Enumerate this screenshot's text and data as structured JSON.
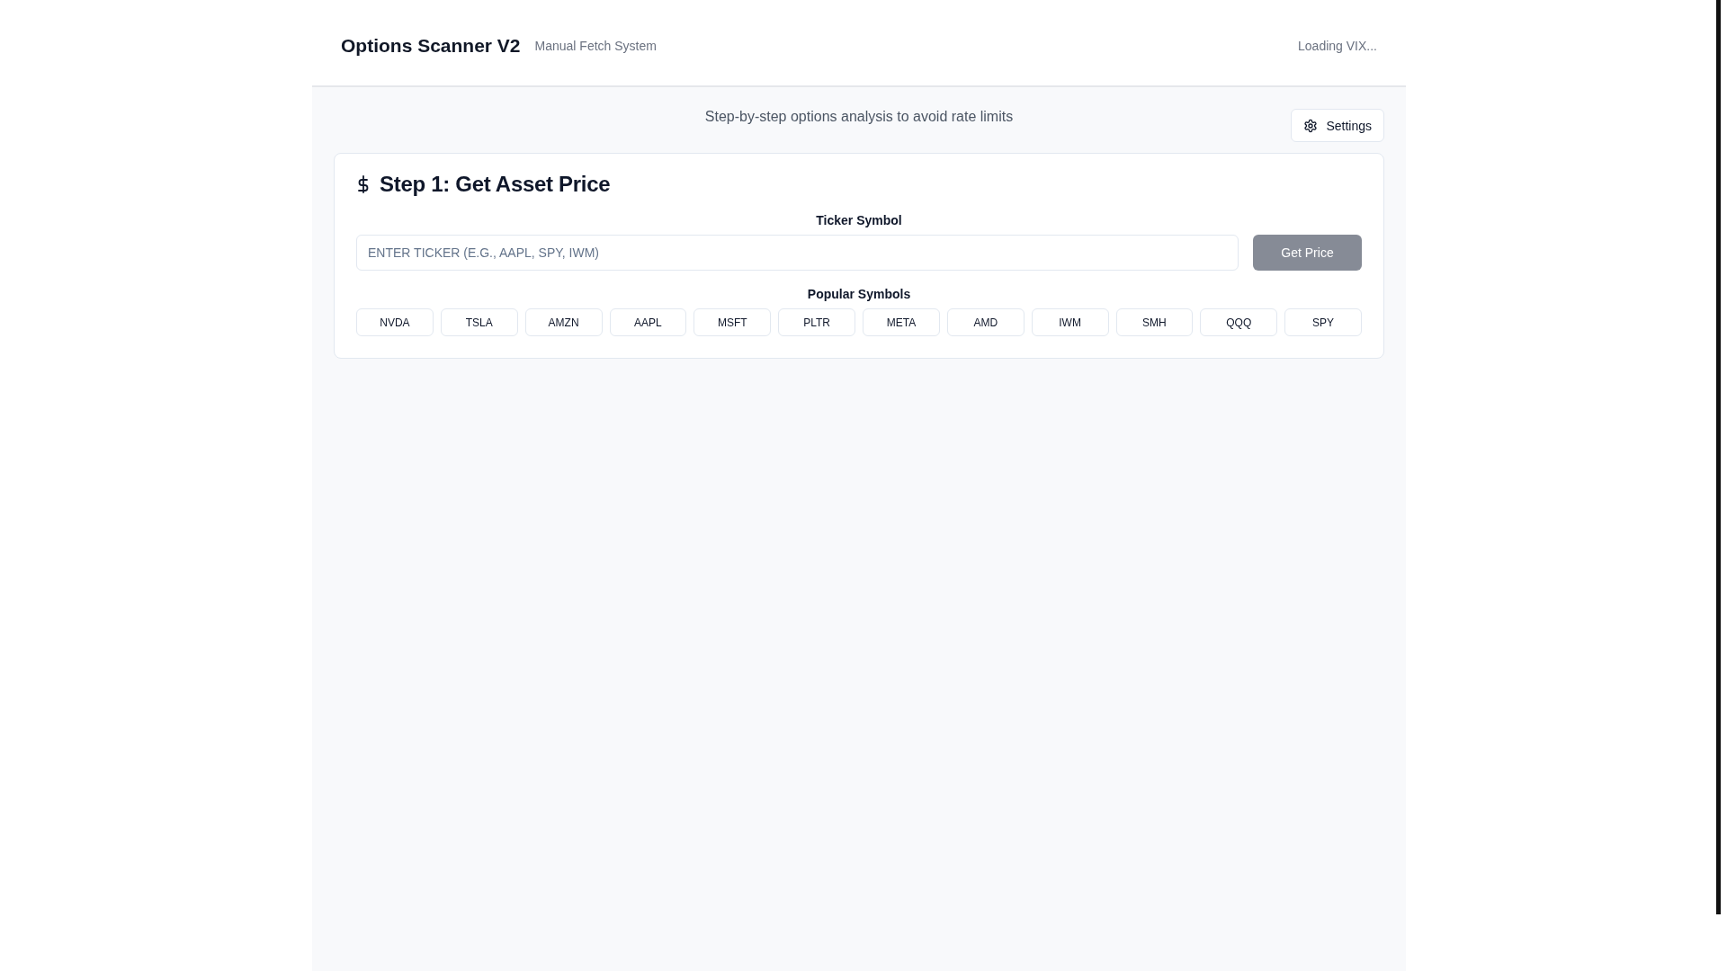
{
  "header": {
    "title": "Options Scanner V2",
    "subtitle": "Manual Fetch System",
    "vix_status": "Loading VIX..."
  },
  "tagline": "Step-by-step options analysis to avoid rate limits",
  "settings_button": {
    "label": "Settings"
  },
  "step_card": {
    "title": "Step 1: Get Asset Price",
    "ticker_label": "Ticker Symbol",
    "ticker_input": {
      "placeholder": "ENTER TICKER (E.G., AAPL, SPY, IWM)"
    },
    "get_price_button": {
      "label": "Get Price",
      "disabled": true
    },
    "popular_label": "Popular Symbols",
    "symbols": [
      "NVDA",
      "TSLA",
      "AMZN",
      "AAPL",
      "MSFT",
      "PLTR",
      "META",
      "AMD",
      "IWM",
      "SMH",
      "QQQ",
      "SPY"
    ]
  }
}
